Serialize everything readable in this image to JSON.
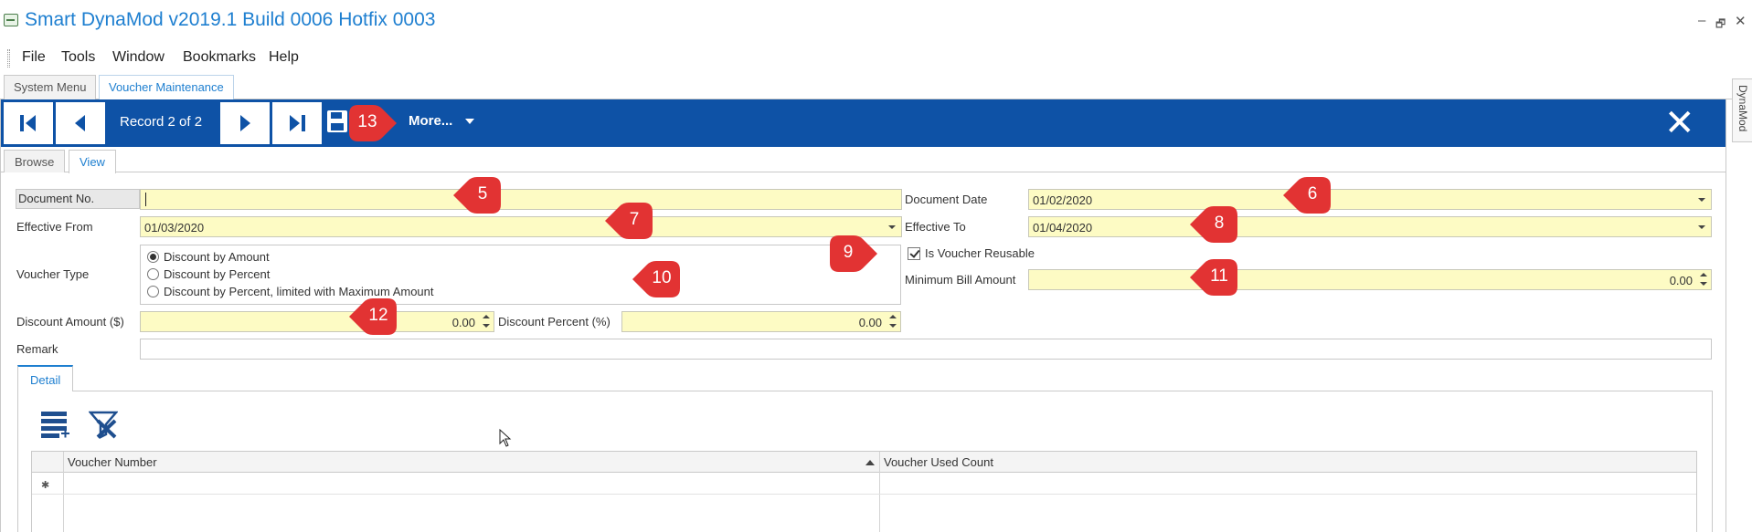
{
  "window": {
    "title": "Smart DynaMod v2019.1 Build 0006 Hotfix 0003",
    "controls": [
      "–",
      "🗗",
      "✕"
    ]
  },
  "menu": [
    "File",
    "Tools",
    "Window",
    "Bookmarks",
    "Help"
  ],
  "top_tabs": [
    "System Menu",
    "Voucher Maintenance"
  ],
  "side_panel": "DynaMod",
  "navigator": {
    "record": "Record 2 of 2",
    "more": "More...",
    "close": "✕"
  },
  "sub_tabs": [
    "Browse",
    "View"
  ],
  "form": {
    "document_no_label": "Document No.",
    "document_no_value": "",
    "document_date_label": "Document Date",
    "document_date_value": "01/02/2020",
    "effective_from_label": "Effective From",
    "effective_from_value": "01/03/2020",
    "effective_to_label": "Effective To",
    "effective_to_value": "01/04/2020",
    "voucher_type_label": "Voucher Type",
    "voucher_types": [
      "Discount by Amount",
      "Discount by Percent",
      "Discount by Percent, limited with Maximum Amount"
    ],
    "voucher_type_selected": 0,
    "reusable_label": "Is Voucher Reusable",
    "reusable_checked": true,
    "min_bill_label": "Minimum Bill Amount",
    "min_bill_value": "0.00",
    "discount_amount_label": "Discount Amount ($)",
    "discount_amount_value": "0.00",
    "discount_percent_label": "Discount Percent (%)",
    "discount_percent_value": "0.00",
    "remark_label": "Remark",
    "remark_value": ""
  },
  "detail": {
    "tab": "Detail",
    "columns": [
      "Voucher Number",
      "Voucher Used Count"
    ],
    "new_row_marker": "✱"
  },
  "callouts": [
    "5",
    "6",
    "7",
    "8",
    "9",
    "10",
    "11",
    "12",
    "13"
  ],
  "colors": {
    "accent": "#1e7fd0",
    "navigator": "#0e52a6",
    "field": "#fdfbc4",
    "callout": "#e23333"
  }
}
